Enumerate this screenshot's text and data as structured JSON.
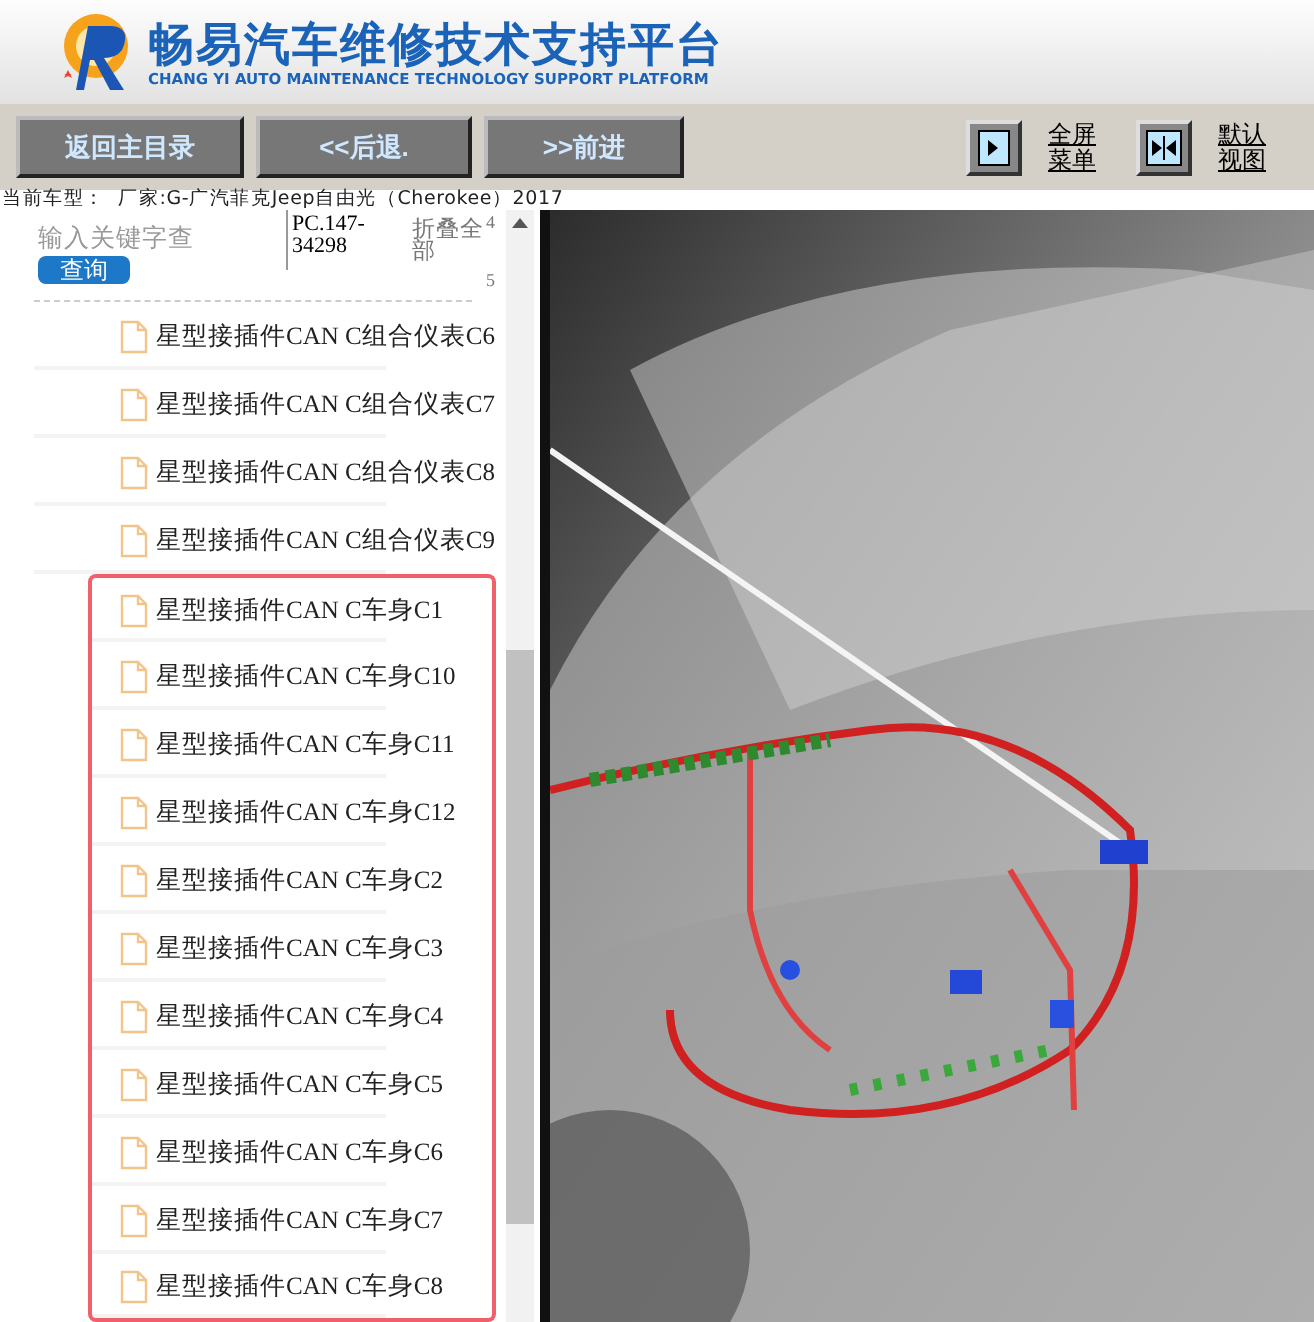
{
  "header": {
    "title": "畅易汽车维修技术支持平台",
    "subtitle": "CHANG YI AUTO MAINTENANCE TECHNOLOGY SUPPORT PLATFORM"
  },
  "toolbar": {
    "nav_buttons": [
      "返回主目录",
      "<<后退.",
      ">>前进"
    ],
    "view_buttons": [
      {
        "kind": "expand",
        "label": "全屏菜单"
      },
      {
        "kind": "default",
        "label": "默认视图"
      }
    ]
  },
  "vehicle_line": "当前车型：  厂家:G-广汽菲克Jeep自由光（Cherokee）2017",
  "sidebar": {
    "search": {
      "placeholder": "输入关键字查",
      "button": "查询"
    },
    "code": "PC.147-34298",
    "collapse_all": "折叠全部",
    "edge_marks": [
      "4",
      "5"
    ],
    "items": [
      {
        "label": "星型接插件CAN C组合仪表C6",
        "highlighted": false
      },
      {
        "label": "星型接插件CAN C组合仪表C7",
        "highlighted": false
      },
      {
        "label": "星型接插件CAN C组合仪表C8",
        "highlighted": false
      },
      {
        "label": "星型接插件CAN C组合仪表C9",
        "highlighted": false
      },
      {
        "label": "星型接插件CAN C车身C1",
        "highlighted": true
      },
      {
        "label": "星型接插件CAN C车身C10",
        "highlighted": true
      },
      {
        "label": "星型接插件CAN C车身C11",
        "highlighted": true
      },
      {
        "label": "星型接插件CAN C车身C12",
        "highlighted": true
      },
      {
        "label": "星型接插件CAN C车身C2",
        "highlighted": true
      },
      {
        "label": "星型接插件CAN C车身C3",
        "highlighted": true
      },
      {
        "label": "星型接插件CAN C车身C4",
        "highlighted": true
      },
      {
        "label": "星型接插件CAN C车身C5",
        "highlighted": true
      },
      {
        "label": "星型接插件CAN C车身C6",
        "highlighted": true
      },
      {
        "label": "星型接插件CAN C车身C7",
        "highlighted": true
      },
      {
        "label": "星型接插件CAN C车身C8",
        "highlighted": true
      }
    ]
  }
}
